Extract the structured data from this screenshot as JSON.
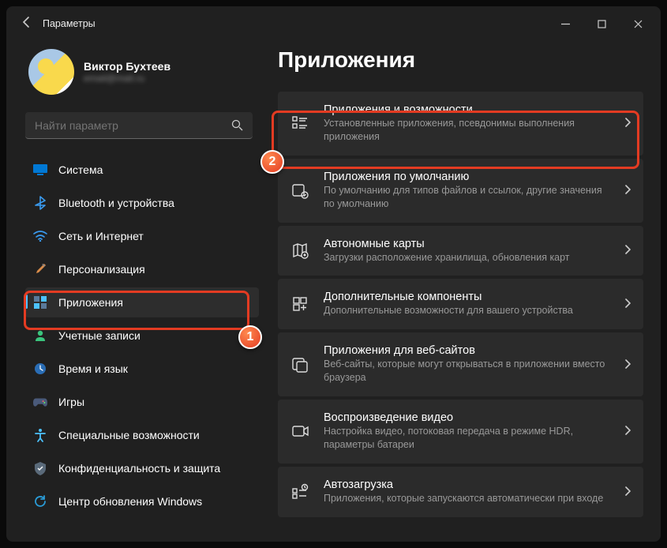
{
  "app_title": "Параметры",
  "profile": {
    "name": "Виктор Бухтеев",
    "email": "email@mail.ru"
  },
  "search": {
    "placeholder": "Найти параметр"
  },
  "nav": [
    {
      "id": "system",
      "label": "Система"
    },
    {
      "id": "bluetooth",
      "label": "Bluetooth и устройства"
    },
    {
      "id": "network",
      "label": "Сеть и Интернет"
    },
    {
      "id": "personalize",
      "label": "Персонализация"
    },
    {
      "id": "apps",
      "label": "Приложения",
      "selected": true
    },
    {
      "id": "accounts",
      "label": "Учетные записи"
    },
    {
      "id": "time",
      "label": "Время и язык"
    },
    {
      "id": "gaming",
      "label": "Игры"
    },
    {
      "id": "access",
      "label": "Специальные возможности"
    },
    {
      "id": "privacy",
      "label": "Конфиденциальность и защита"
    },
    {
      "id": "update",
      "label": "Центр обновления Windows"
    }
  ],
  "page": {
    "title": "Приложения"
  },
  "cards": [
    {
      "id": "apps-features",
      "title": "Приложения и возможности",
      "sub": "Установленные приложения, псевдонимы выполнения приложения"
    },
    {
      "id": "default-apps",
      "title": "Приложения по умолчанию",
      "sub": "По умолчанию для типов файлов и ссылок, другие значения по умолчанию"
    },
    {
      "id": "offline-maps",
      "title": "Автономные карты",
      "sub": "Загрузки расположение хранилища, обновления карт"
    },
    {
      "id": "optional",
      "title": "Дополнительные компоненты",
      "sub": "Дополнительные возможности для вашего устройства"
    },
    {
      "id": "apps-websites",
      "title": "Приложения для веб-сайтов",
      "sub": "Веб-сайты, которые могут открываться в приложении вместо браузера"
    },
    {
      "id": "video",
      "title": "Воспроизведение видео",
      "sub": "Настройка видео, потоковая передача в режиме HDR, параметры батареи"
    },
    {
      "id": "startup",
      "title": "Автозагрузка",
      "sub": "Приложения, которые запускаются автоматически при входе"
    }
  ],
  "annotations": {
    "badge1": "1",
    "badge2": "2"
  }
}
